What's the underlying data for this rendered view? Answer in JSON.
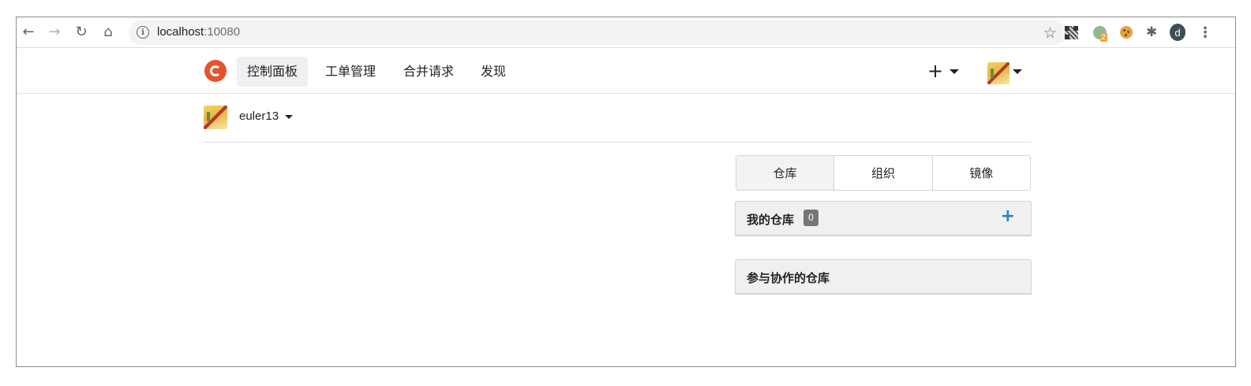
{
  "browser": {
    "url_host": "localhost",
    "url_port": ":10080",
    "profile_initial": "d",
    "ext_badge": "2",
    "icons": {
      "back": "back-arrow-icon",
      "forward": "forward-arrow-icon",
      "reload": "reload-icon",
      "home": "home-icon",
      "info": "info-icon",
      "bookmark": "star-icon",
      "menu": "kebab-menu-icon"
    }
  },
  "nav": {
    "items": [
      {
        "label": "控制面板",
        "active": true
      },
      {
        "label": "工单管理",
        "active": false
      },
      {
        "label": "合并请求",
        "active": false
      },
      {
        "label": "发现",
        "active": false
      }
    ],
    "plus_symbol": "+"
  },
  "context": {
    "username": "euler13"
  },
  "tabs": [
    {
      "label": "仓库",
      "active": true
    },
    {
      "label": "组织",
      "active": false
    },
    {
      "label": "镜像",
      "active": false
    }
  ],
  "my_repos": {
    "title": "我的仓库",
    "count": "0",
    "add_symbol": "+"
  },
  "collab_repos": {
    "title": "参与协作的仓库"
  },
  "colors": {
    "brand": "#e6532d",
    "link_blue": "#2185d0",
    "count_bg": "#767676"
  }
}
